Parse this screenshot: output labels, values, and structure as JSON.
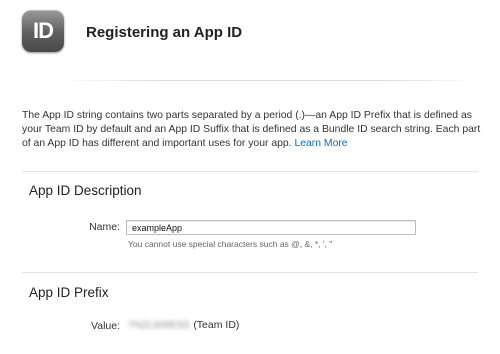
{
  "header": {
    "icon_text": "ID",
    "title": "Registering an App ID"
  },
  "intro": {
    "text": "The App ID string contains two parts separated by a period (.)—an App ID Prefix that is defined as your Team ID by default and an App ID Suffix that is defined as a Bundle ID search string. Each part of an App ID has different and important uses for your app.",
    "link": "Learn More"
  },
  "description": {
    "title": "App ID Description",
    "name_label": "Name:",
    "name_value": "exampleApp",
    "hint": "You cannot use special characters such as @, &, *, ', \""
  },
  "prefix": {
    "title": "App ID Prefix",
    "value_label": "Value:",
    "value_redacted": "7N2L949E93",
    "value_suffix": "(Team ID)"
  }
}
